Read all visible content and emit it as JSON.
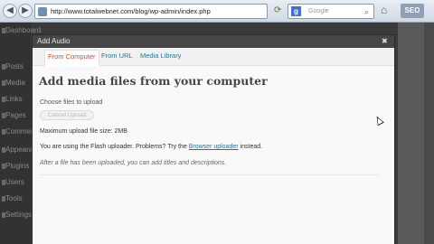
{
  "browser": {
    "url": "http://www.totalwebnet.com/blog/wp-admin/index.php",
    "search_engine_icon": "g",
    "search_placeholder": "Google",
    "seo_label": "SEO"
  },
  "admin_sidebar": {
    "items": [
      "Dashboard",
      "Posts",
      "Media",
      "Links",
      "Pages",
      "Comments",
      "Appearance",
      "Plugins",
      "Users",
      "Tools",
      "Settings"
    ]
  },
  "dialog": {
    "title": "Add Audio",
    "tabs": [
      {
        "label": "From Computer",
        "active": true
      },
      {
        "label": "From URL",
        "active": false
      },
      {
        "label": "Media Library",
        "active": false
      }
    ],
    "heading": "Add media files from your computer",
    "choose_label": "Choose files to upload",
    "cancel_label": "Cancel Upload",
    "max_size": "Maximum upload file size: 2MB",
    "flash_prefix": "You are using the Flash uploader. Problems? Try the ",
    "flash_link": "Browser uploader",
    "flash_suffix": " instead.",
    "after_upload": "After a file has been uploaded, you can add titles and descriptions."
  },
  "colors": {
    "link": "#21759b",
    "active_tab": "#d54e21",
    "dialog_title_bg": "#464646"
  }
}
